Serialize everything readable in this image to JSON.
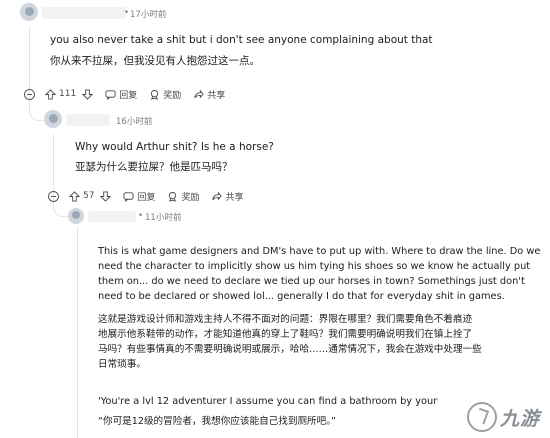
{
  "comments": [
    {
      "time": "17小时前",
      "body_en": "you also never take a shit but i don't see anyone complaining about that",
      "body_zh": "你从来不拉屎，但我没见有人抱怨过这一点。",
      "votes": "111",
      "reply_label": "回复",
      "award_label": "奖励",
      "share_label": "共享"
    },
    {
      "time": "16小时前",
      "body_en": "Why would Arthur shit? Is he a horse?",
      "body_zh": "亚瑟为什么要拉屎？他是匹马吗？",
      "votes": "57",
      "reply_label": "回复",
      "award_label": "奖励",
      "share_label": "共享"
    },
    {
      "time": "11小时前",
      "para1": [
        "This is what game designers and DM's have to put up with. Where to draw the line. Do we",
        "need the character to implicitly show us him tying his shoes so we know he actually put",
        "them on... do we need to declare we tied up our horses in town? Somethings just don't",
        "need to be declared or showed lol... generally I do that for everyday shit in games."
      ],
      "para2": [
        "这就是游戏设计师和游戏主持人不得不面对的问题：界限在哪里？我们需要角色不着痕迹",
        "地展示他系鞋带的动作，才能知道他真的穿上了鞋吗？我们需要明确说明我们在镇上拴了",
        "马吗？有些事情真的不需要明确说明或展示，哈哈……通常情况下，我会在游戏中处理一些",
        "日常琐事。"
      ],
      "quote_en": "'You're a lvl 12 adventurer I assume you can find a bathroom by yours",
      "quote_zh": "“你可是12级的冒险者，我想你应该能自己找到厕所吧。”"
    }
  ],
  "watermark": {
    "text": "九游"
  },
  "colors": {
    "text": "#1c1c1c",
    "meta": "#7c7c7c",
    "thread": "#e2e5e8"
  }
}
